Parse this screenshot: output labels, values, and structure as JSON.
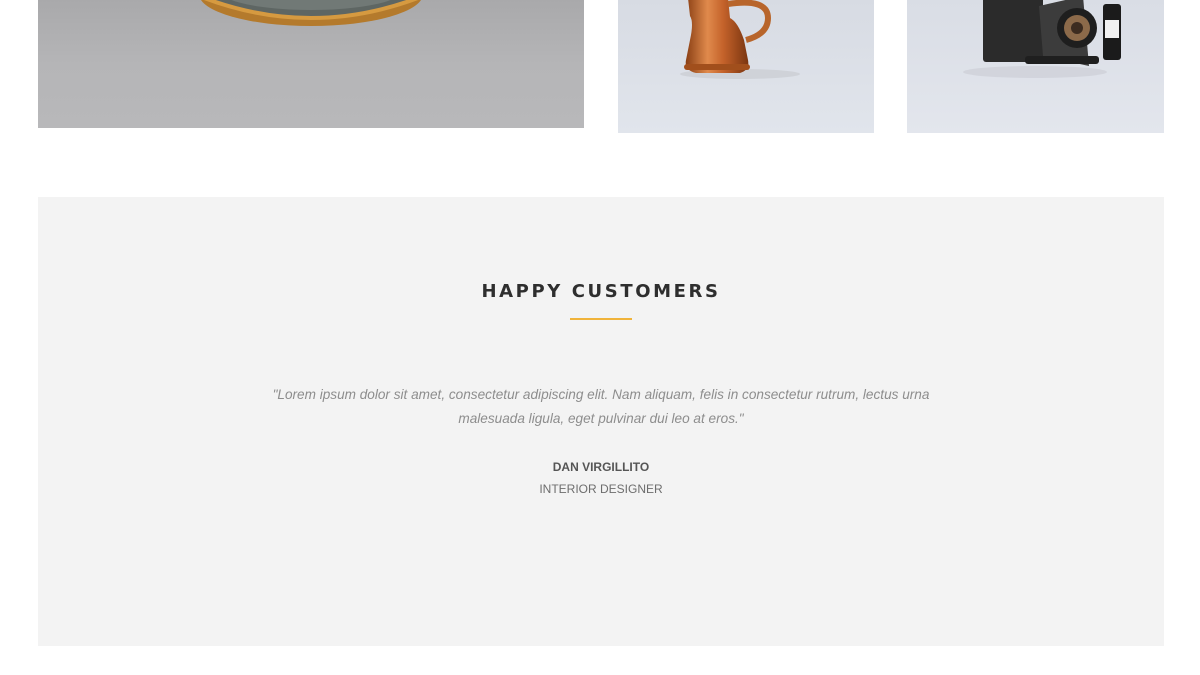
{
  "products": [
    {
      "name": "round brass object",
      "image": "brass-tray"
    },
    {
      "name": "copper kettle",
      "image": "copper-kettle"
    },
    {
      "name": "vintage folding camera",
      "image": "folding-camera"
    }
  ],
  "testimonials": {
    "title": "HAPPY CUSTOMERS",
    "quote": "\"Lorem ipsum dolor sit amet, consectetur adipiscing elit. Nam aliquam, felis in consectetur rutrum, lectus urna malesuada ligula, eget pulvinar dui leo at eros.\"",
    "author": "DAN VIRGILLITO",
    "role": "INTERIOR DESIGNER"
  },
  "colors": {
    "accent": "#f0b33a",
    "section_bg": "#f3f3f3",
    "heading": "#2e2e2e",
    "quote_text": "#8d8d8d"
  }
}
